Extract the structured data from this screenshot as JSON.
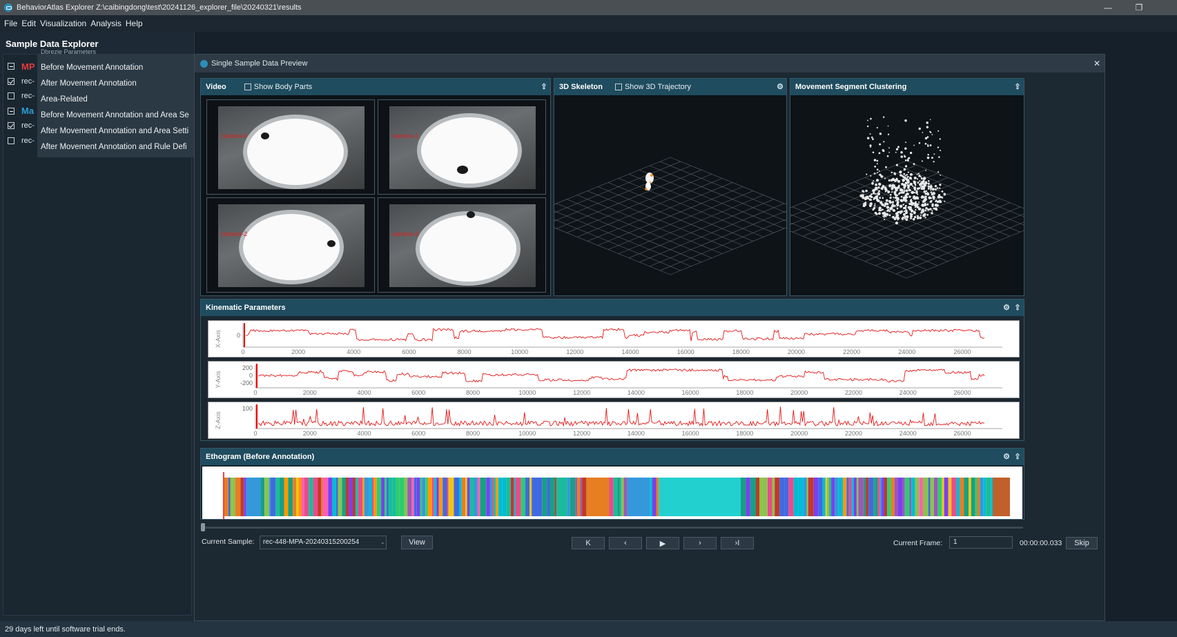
{
  "window": {
    "title": "BehaviorAtlas Explorer Z:\\caibingdong\\test\\20241126_explorer_file\\20240321\\results",
    "minimize": "—",
    "restore": "❐",
    "close": "✕"
  },
  "menu": [
    "File",
    "Edit",
    "Visualization",
    "Analysis",
    "Help"
  ],
  "left": {
    "title": "Sample Data Explorer",
    "rows": [
      {
        "state": "minus",
        "text": "MP",
        "color": "#e33b3b",
        "bold": true
      },
      {
        "state": "checked",
        "text": "rec-",
        "color": "#dfe6ea",
        "bold": false
      },
      {
        "state": "none",
        "text": "rec-",
        "color": "#dfe6ea",
        "bold": false
      },
      {
        "state": "minus",
        "text": "Ma",
        "color": "#2a9fd6",
        "bold": true
      },
      {
        "state": "checked",
        "text": "rec-",
        "color": "#dfe6ea",
        "bold": false
      },
      {
        "state": "none",
        "text": "rec-",
        "color": "#dfe6ea",
        "bold": false
      }
    ],
    "popup_partial": "Dbrezie Parameters",
    "popup": [
      "Before Movement Annotation",
      "After Movement Annotation",
      "Area-Related",
      "Before Movement Annotation and Area Se",
      "After Movement Annotation and Area Setti",
      "After Movement Annotation and Rule Defi"
    ]
  },
  "dialog": {
    "title": "Single Sample Data Preview",
    "close": "✕"
  },
  "video": {
    "title": "Video",
    "checkbox": "Show Body Parts",
    "cameras": [
      "camera-0",
      "camera-1",
      "camera-2",
      "camera-3"
    ]
  },
  "skeleton": {
    "title": "3D Skeleton",
    "checkbox": "Show 3D Trajectory"
  },
  "cluster": {
    "title": "Movement Segment Clustering"
  },
  "kinematic": {
    "title": "Kinematic Parameters",
    "charts": [
      {
        "axis": "X-Axis",
        "yticks": [
          "0"
        ],
        "xticks": [
          "0",
          "2000",
          "4000",
          "6000",
          "8000",
          "10000",
          "12000",
          "14000",
          "16000",
          "18000",
          "20000",
          "22000",
          "24000",
          "26000"
        ]
      },
      {
        "axis": "Y-Axis",
        "yticks": [
          "200",
          "0",
          "-200"
        ],
        "xticks": [
          "0",
          "2000",
          "4000",
          "6000",
          "8000",
          "10000",
          "12000",
          "14000",
          "16000",
          "18000",
          "20000",
          "22000",
          "24000",
          "26000"
        ]
      },
      {
        "axis": "Z-Axis",
        "yticks": [
          "100"
        ],
        "xticks": [
          "0",
          "2000",
          "4000",
          "6000",
          "8000",
          "10000",
          "12000",
          "14000",
          "16000",
          "18000",
          "20000",
          "22000",
          "24000",
          "26000"
        ]
      }
    ]
  },
  "ethogram": {
    "title": "Ethogram (Before Annotation)"
  },
  "controls": {
    "sample_label": "Current Sample:",
    "sample_value": "rec-448-MPA-20240315200254",
    "view": "View",
    "first": "K",
    "prev": "‹",
    "play": "▶",
    "next": "›",
    "last": "›I",
    "frame_label": "Current Frame:",
    "frame_value": "1",
    "time": "00:00:00.033",
    "skip": "Skip"
  },
  "status": "29 days left until software trial ends."
}
